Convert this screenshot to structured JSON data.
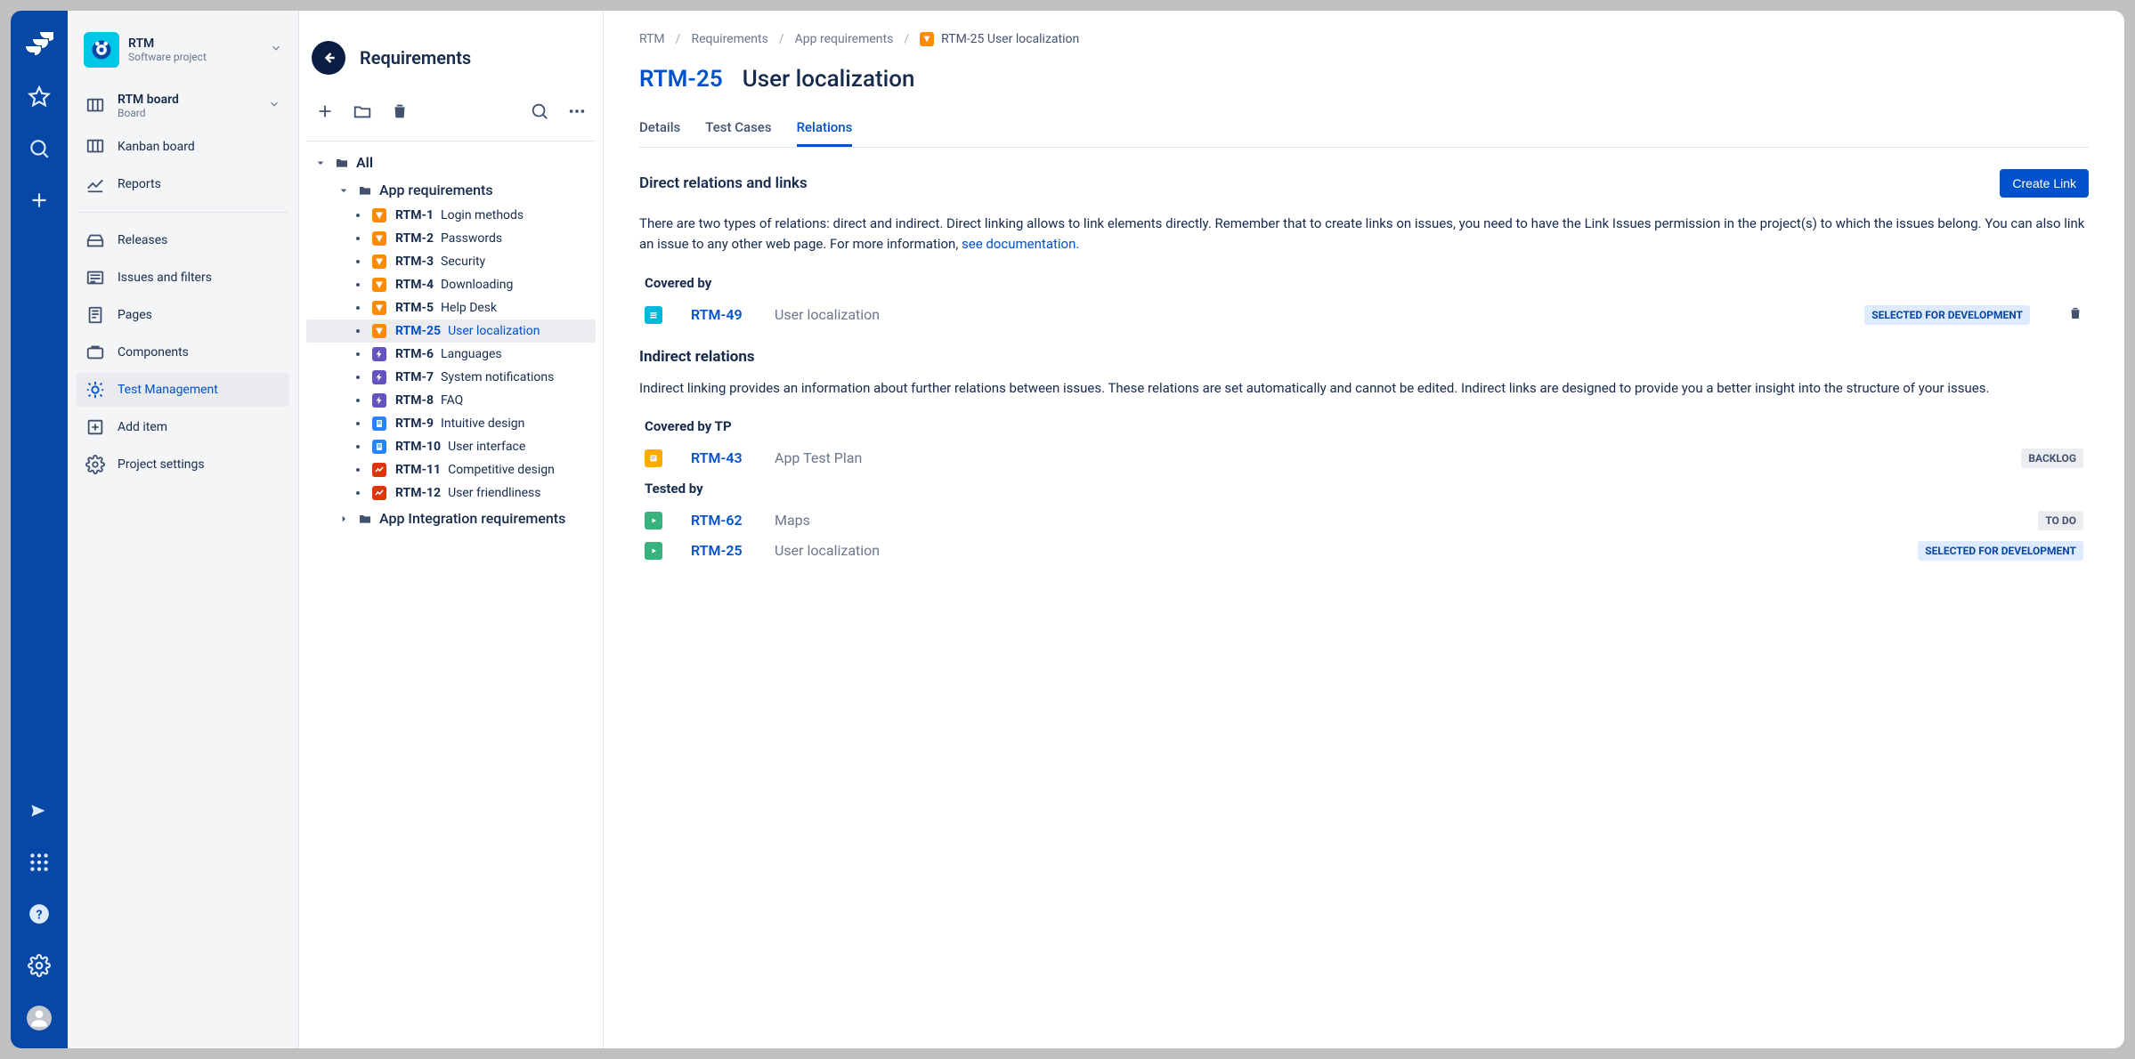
{
  "rail": {},
  "project": {
    "name": "RTM",
    "subtitle": "Software project",
    "board_label": "RTM board",
    "board_sub": "Board",
    "kanban_label": "Kanban board",
    "reports_label": "Reports",
    "releases_label": "Releases",
    "issues_label": "Issues and filters",
    "pages_label": "Pages",
    "components_label": "Components",
    "tm_label": "Test Management",
    "add_item_label": "Add item",
    "settings_label": "Project settings"
  },
  "tree": {
    "title": "Requirements",
    "root_label": "All",
    "folders": [
      {
        "label": "App requirements",
        "expanded": true
      },
      {
        "label": "App Integration requirements",
        "expanded": false
      }
    ],
    "items": [
      {
        "key": "RTM-1",
        "title": "Login methods",
        "icon": "orange-req"
      },
      {
        "key": "RTM-2",
        "title": "Passwords",
        "icon": "orange-req"
      },
      {
        "key": "RTM-3",
        "title": "Security",
        "icon": "orange-req"
      },
      {
        "key": "RTM-4",
        "title": "Downloading",
        "icon": "orange-req"
      },
      {
        "key": "RTM-5",
        "title": "Help Desk",
        "icon": "orange-req"
      },
      {
        "key": "RTM-25",
        "title": "User localization",
        "icon": "orange-req",
        "active": true
      },
      {
        "key": "RTM-6",
        "title": "Languages",
        "icon": "purple-bolt"
      },
      {
        "key": "RTM-7",
        "title": "System notifications",
        "icon": "purple-bolt"
      },
      {
        "key": "RTM-8",
        "title": "FAQ",
        "icon": "purple-bolt"
      },
      {
        "key": "RTM-9",
        "title": "Intuitive design",
        "icon": "blue-doc"
      },
      {
        "key": "RTM-10",
        "title": "User interface",
        "icon": "blue-doc"
      },
      {
        "key": "RTM-11",
        "title": "Competitive design",
        "icon": "red-chart"
      },
      {
        "key": "RTM-12",
        "title": "User friendliness",
        "icon": "red-chart"
      }
    ]
  },
  "crumbs": {
    "c0": "RTM",
    "c1": "Requirements",
    "c2": "App requirements",
    "c3": "RTM-25 User localization"
  },
  "issue": {
    "key": "RTM-25",
    "title": "User localization",
    "tabs": {
      "details": "Details",
      "test_cases": "Test Cases",
      "relations": "Relations"
    },
    "active_tab": "relations"
  },
  "relations": {
    "direct_heading": "Direct relations and links",
    "create_link_label": "Create Link",
    "direct_desc_a": "There are two types of relations: direct and indirect. Direct linking allows to link elements directly. Remember that to create links on issues, you need to have the Link Issues permission in the project(s) to which the issues belong. You can also link an issue to any other web page. For more information, ",
    "direct_desc_link": "see documentation.",
    "covered_by_label": "Covered by",
    "covered_by": [
      {
        "icon": "teal-list",
        "key": "RTM-49",
        "text": "User localization",
        "status": "SELECTED FOR DEVELOPMENT",
        "status_style": "blue",
        "deletable": true
      }
    ],
    "indirect_heading": "Indirect relations",
    "indirect_desc": "Indirect linking provides an information about further relations between issues. These relations are set automatically and cannot be edited. Indirect links are designed to provide you a better insight into the structure of your issues.",
    "covered_by_tp_label": "Covered by TP",
    "covered_by_tp": [
      {
        "icon": "yellow-plan",
        "key": "RTM-43",
        "text": "App Test Plan",
        "status": "BACKLOG",
        "status_style": "grey"
      }
    ],
    "tested_by_label": "Tested by",
    "tested_by": [
      {
        "icon": "green-exec",
        "key": "RTM-62",
        "text": "Maps",
        "status": "TO DO",
        "status_style": "grey"
      },
      {
        "icon": "green-exec",
        "key": "RTM-25",
        "text": "User localization",
        "status": "SELECTED FOR DEVELOPMENT",
        "status_style": "blue"
      }
    ]
  }
}
